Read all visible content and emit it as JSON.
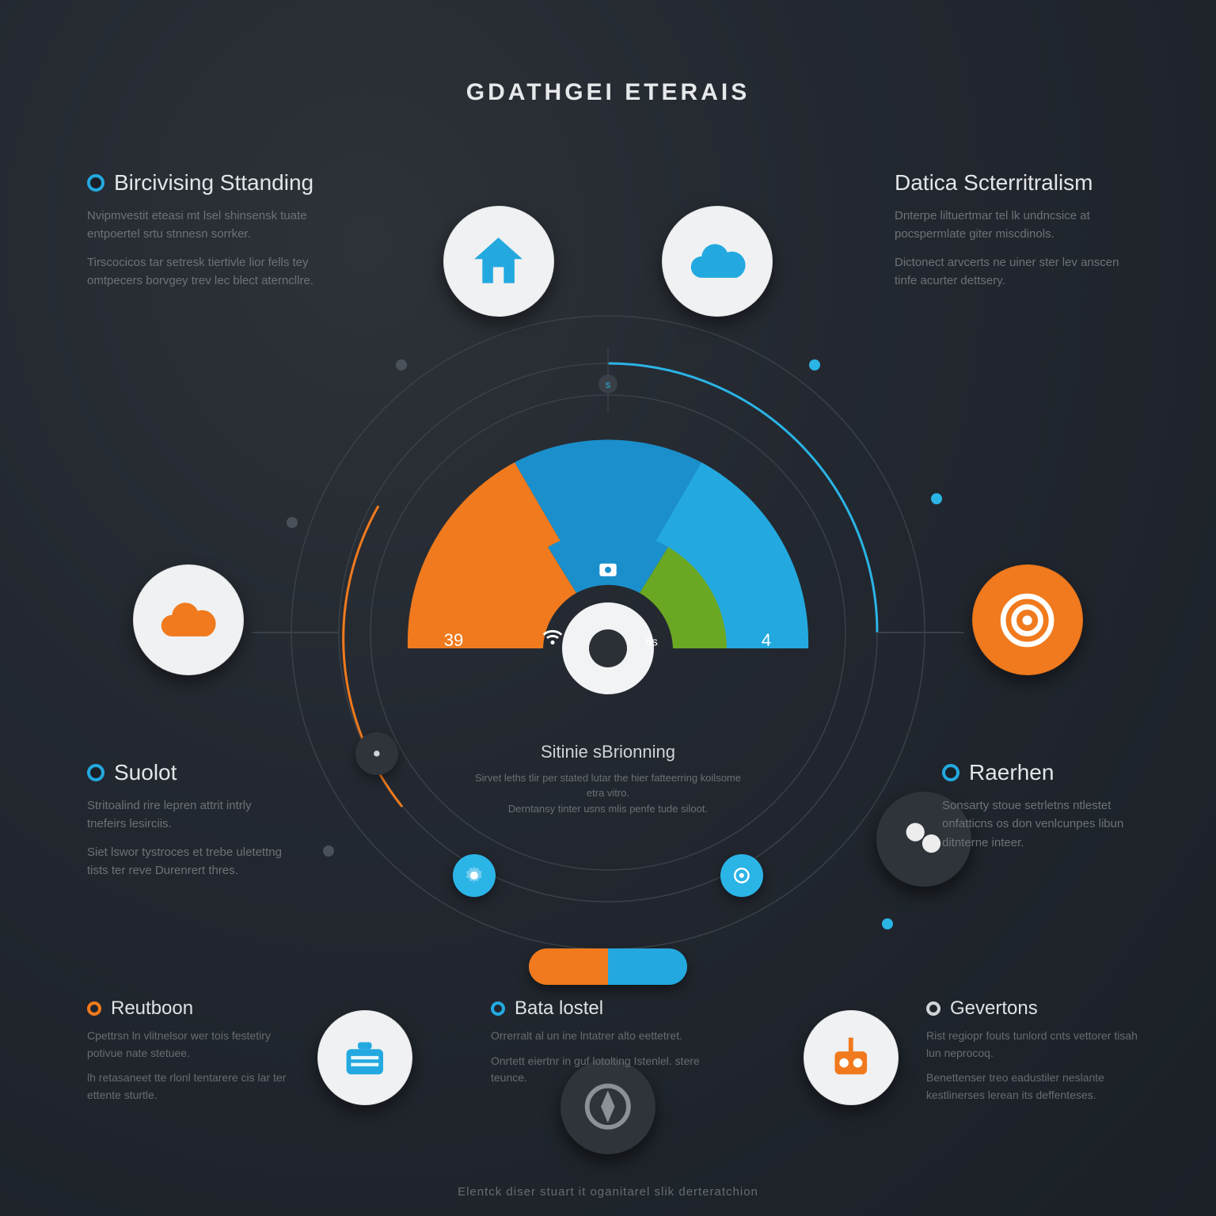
{
  "title": "GDATHGEI ETERAIS",
  "footer": "Elentck diser stuart it oganitarel slik derteratchion",
  "colors": {
    "cyan": "#23a9e0",
    "cyan_light": "#2bb4e6",
    "orange": "#f07a1d",
    "green": "#6aa723",
    "blue_mid": "#1b7bb4",
    "bg": "#1f242b"
  },
  "gauge": {
    "left_value": "39",
    "right_value": "4",
    "center_small": "6s"
  },
  "center": {
    "heading": "Sitinie sBrionning",
    "body1": "Sirvet leths tlir per stated lutar the hier fatteerring koilsome etra vitro.",
    "body2": "Derntansy tinter usns mlis penfe tude siloot."
  },
  "callouts": {
    "top_left": {
      "heading": "Bircivising Sttanding",
      "body1": "Nvipmvestit eteasi mt lsel shinsensk tuate entpoertel srtu stnnesn sorrker.",
      "body2": "Tirscocicos tar setresk tiertivle lior fells tey omtpecers borvgey trev lec blect aterncllre."
    },
    "top_right": {
      "heading": "Datica Scterritralism",
      "body1": "Dnterpe liltuertmar tel lk undncsice at pocspermlate giter miscdinols.",
      "body2": "Dictonect arvcerts ne uiner ster lev anscen tinfe acurter dettsery."
    },
    "mid_left": {
      "heading": "Suolot",
      "body1": "Stritoalind rire lepren attrit intrly tnefeirs lesirciis.",
      "body2": "Siet lswor tystroces et trebe uletettng tists ter reve Durenrert thres."
    },
    "mid_right": {
      "heading": "Raerhen",
      "body1": "Sonsarty stoue setrletns ntlestet onfatticns os don venlcunpes libun ditnterne inteer."
    }
  },
  "bottom": {
    "left": {
      "heading": "Reutboon",
      "body1": "Cpettrsn ln vlitnelsor wer tois festetiry potivue nate stetuee.",
      "body2": "lh retasaneet tte rlonl tentarere cis lar ter ettente sturtle."
    },
    "center": {
      "heading": "Bata lostel",
      "body1": "Orrerralt al un ine lntatrer alto eettetret.",
      "body2": "Onrtett eiertnr in guf lotolting Istenlel. stere teunce."
    },
    "right": {
      "heading": "Gevertons",
      "body1": "Rist regiopr fouts tunlord cnts vettorer tisah lun neprocoq.",
      "body2": "Benettenser treo eadustiler neslante kestlinerses lerean its deffenteses."
    }
  },
  "icons": {
    "home": "home-icon",
    "cloud": "cloud-icon",
    "target": "target-icon",
    "briefcase": "briefcase-icon",
    "radio": "radio-icon",
    "wifi": "wifi-icon",
    "gear": "gear-icon",
    "camera": "camera-icon",
    "cursor": "cursor-icon"
  }
}
